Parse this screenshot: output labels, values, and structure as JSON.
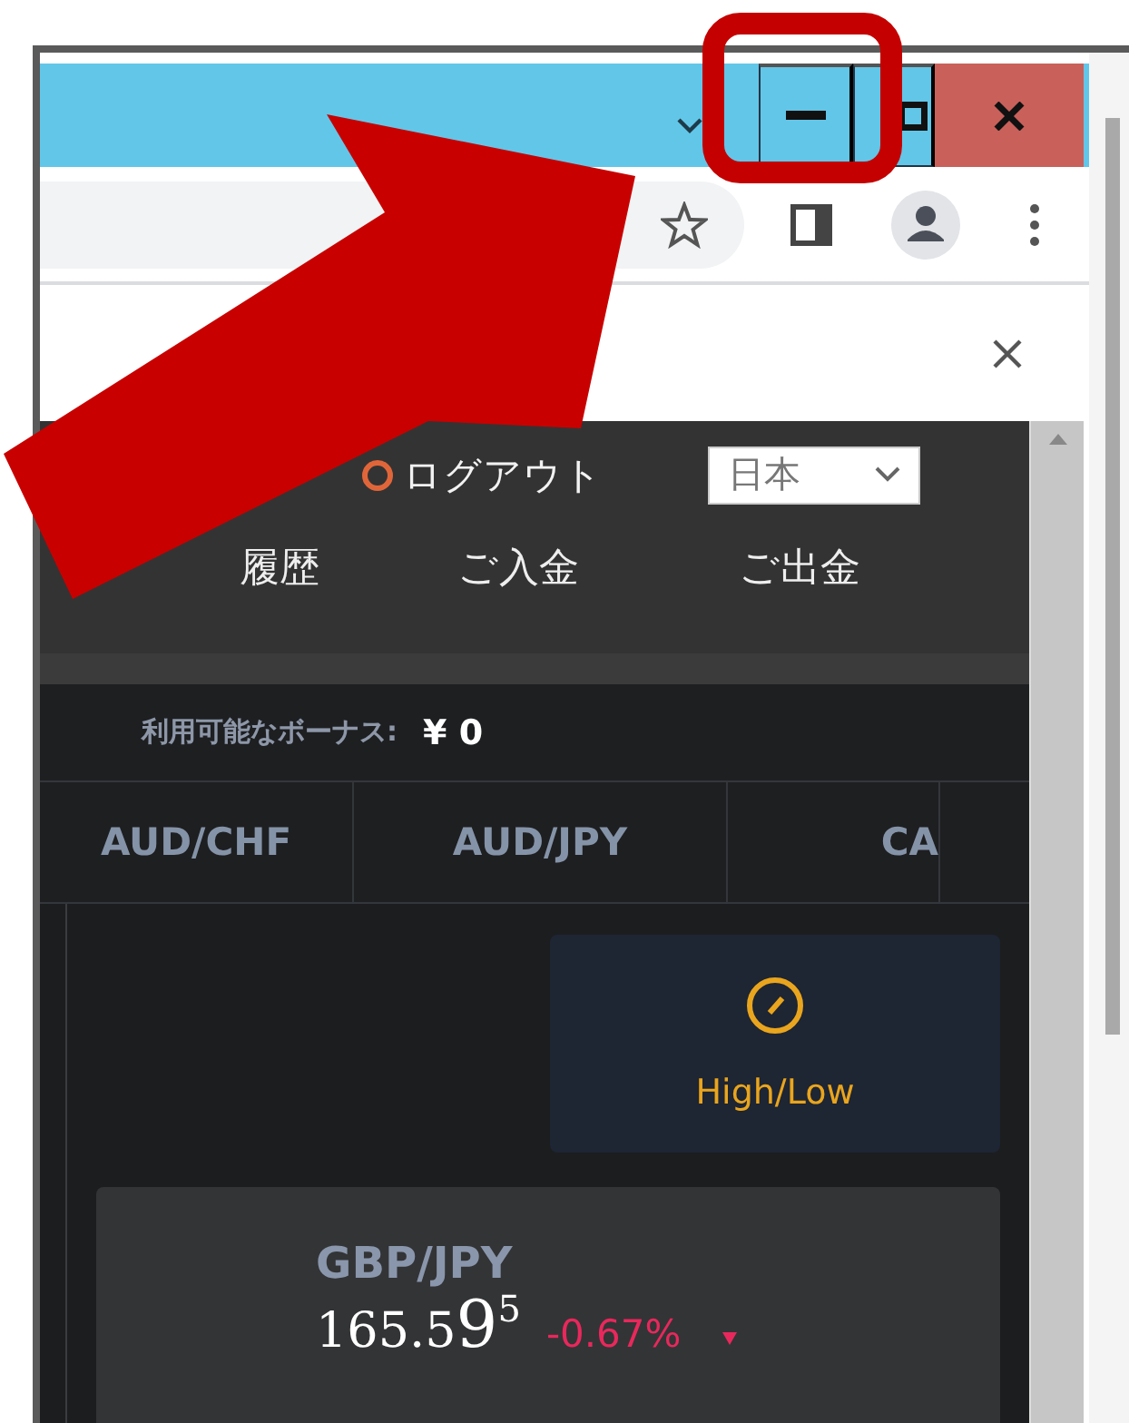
{
  "site_header": {
    "logout": "ログアウト",
    "language": {
      "value": "日本"
    },
    "nav": [
      "履歴",
      "ご入金",
      "ご出金"
    ]
  },
  "bonus": {
    "label": "利用可能なボーナス:",
    "value": "¥ 0"
  },
  "pair_tabs": [
    {
      "label": "AUD/CHF"
    },
    {
      "label": "AUD/JPY"
    },
    {
      "label": "CA"
    }
  ],
  "trade_mode": {
    "label": "High/Low"
  },
  "quote": {
    "pair": "GBP/JPY",
    "price": "165.5",
    "price_big": "9",
    "price_sup": "5",
    "change": "-0.67%",
    "falling": true
  },
  "annotations": {
    "highlight_frame": true,
    "pointer_arrow": true
  }
}
